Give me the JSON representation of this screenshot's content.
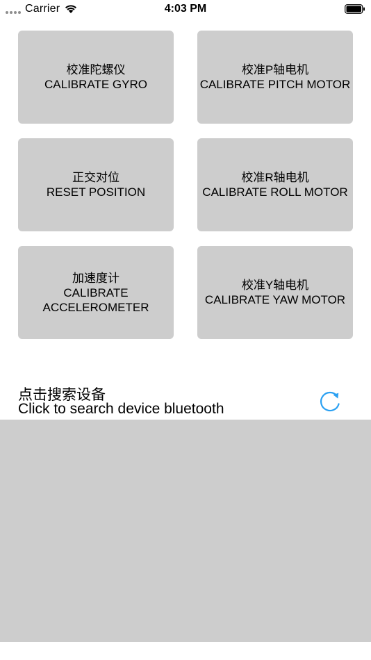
{
  "status_bar": {
    "carrier": "Carrier",
    "time": "4:03 PM",
    "icons": [
      "signal-dots-icon",
      "wifi-icon",
      "battery-icon"
    ]
  },
  "buttons": [
    {
      "zh": "校准陀螺仪",
      "en": "CALIBRATE GYRO"
    },
    {
      "zh": "校准P轴电机",
      "en": "CALIBRATE PITCH MOTOR"
    },
    {
      "zh": "正交对位",
      "en": "RESET POSITION"
    },
    {
      "zh": "校准R轴电机",
      "en": "CALIBRATE ROLL MOTOR"
    },
    {
      "zh": "加速度计",
      "en": "CALIBRATE ACCELEROMETER"
    },
    {
      "zh": "校准Y轴电机",
      "en": "CALIBRATE YAW MOTOR"
    }
  ],
  "search": {
    "zh": "点击搜索设备",
    "en": "Click to search device bluetooth",
    "icon": "refresh-icon"
  },
  "colors": {
    "button_bg": "#cdcdcd",
    "accent": "#2aa0f2",
    "list_bg": "#cdcdcd"
  }
}
